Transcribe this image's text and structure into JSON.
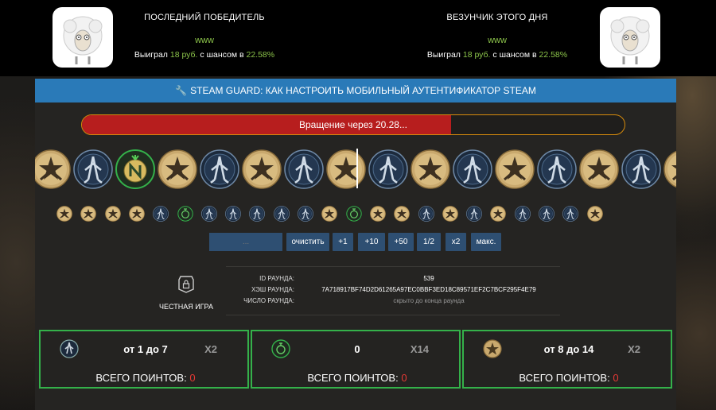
{
  "last_winner": {
    "title": "ПОСЛЕДНИЙ ПОБЕДИТЕЛЬ",
    "name": "www",
    "won_prefix": "Выиграл",
    "amount": "18 руб.",
    "chance_prefix": "с шансом в",
    "chance": "22.58%"
  },
  "lucky_winner": {
    "title": "ВЕЗУНЧИК ЭТОГО ДНЯ",
    "name": "www",
    "won_prefix": "Выиграл",
    "amount": "18 руб.",
    "chance_prefix": "с шансом в",
    "chance": "22.58%"
  },
  "banner": {
    "text": "STEAM GUARD: КАК НАСТРОИТЬ МОБИЛЬНЫЙ АУТЕНТИФИКАТОР STEAM"
  },
  "roll": {
    "label": "Вращение через 20.28...",
    "progress": 0.68
  },
  "colors": {
    "gold": "#c9a96e",
    "ct": "#3d5a80",
    "green": "#34b14a",
    "red": "#e53935",
    "banner": "#2a7ab8",
    "progress": "#b71e1e",
    "accent": "#8bc34a"
  },
  "reel": [
    "t",
    "ct",
    "n",
    "t",
    "ct",
    "t",
    "ct",
    "t",
    "ct",
    "t",
    "ct",
    "t",
    "ct",
    "t",
    "ct",
    "t"
  ],
  "history": [
    "t",
    "t",
    "t",
    "t",
    "ct",
    "g",
    "ct",
    "ct",
    "ct",
    "ct",
    "ct",
    "t",
    "g",
    "t",
    "t",
    "ct",
    "t",
    "ct",
    "t",
    "ct",
    "ct",
    "ct",
    "t"
  ],
  "bet": {
    "placeholder": "...",
    "buttons": [
      "очистить",
      "+1",
      "+10",
      "+50",
      "1/2",
      "x2",
      "макс."
    ]
  },
  "fair": {
    "label": "ЧЕСТНАЯ ИГРА",
    "icon": "lock-icon"
  },
  "round": {
    "id_label": "ID РАУНДА:",
    "id": "539",
    "hash_label": "ХЭШ РАУНДА:",
    "hash": "7A718917BF74D2D61265A97EC0BBF3ED18C89571EF2C7BCF295F4E79",
    "number_label": "ЧИСЛО РАУНДА:",
    "number": "скрыто до конца раунда"
  },
  "cards": [
    {
      "icon": "ct-icon",
      "range": "от 1 до 7",
      "mult": "X2",
      "total_label": "ВСЕГО ПОИНТОВ:",
      "total": "0"
    },
    {
      "icon": "bomb-icon",
      "range": "0",
      "mult": "X14",
      "total_label": "ВСЕГО ПОИНТОВ:",
      "total": "0"
    },
    {
      "icon": "t-icon",
      "range": "от 8 до 14",
      "mult": "X2",
      "total_label": "ВСЕГО ПОИНТОВ:",
      "total": "0"
    }
  ]
}
